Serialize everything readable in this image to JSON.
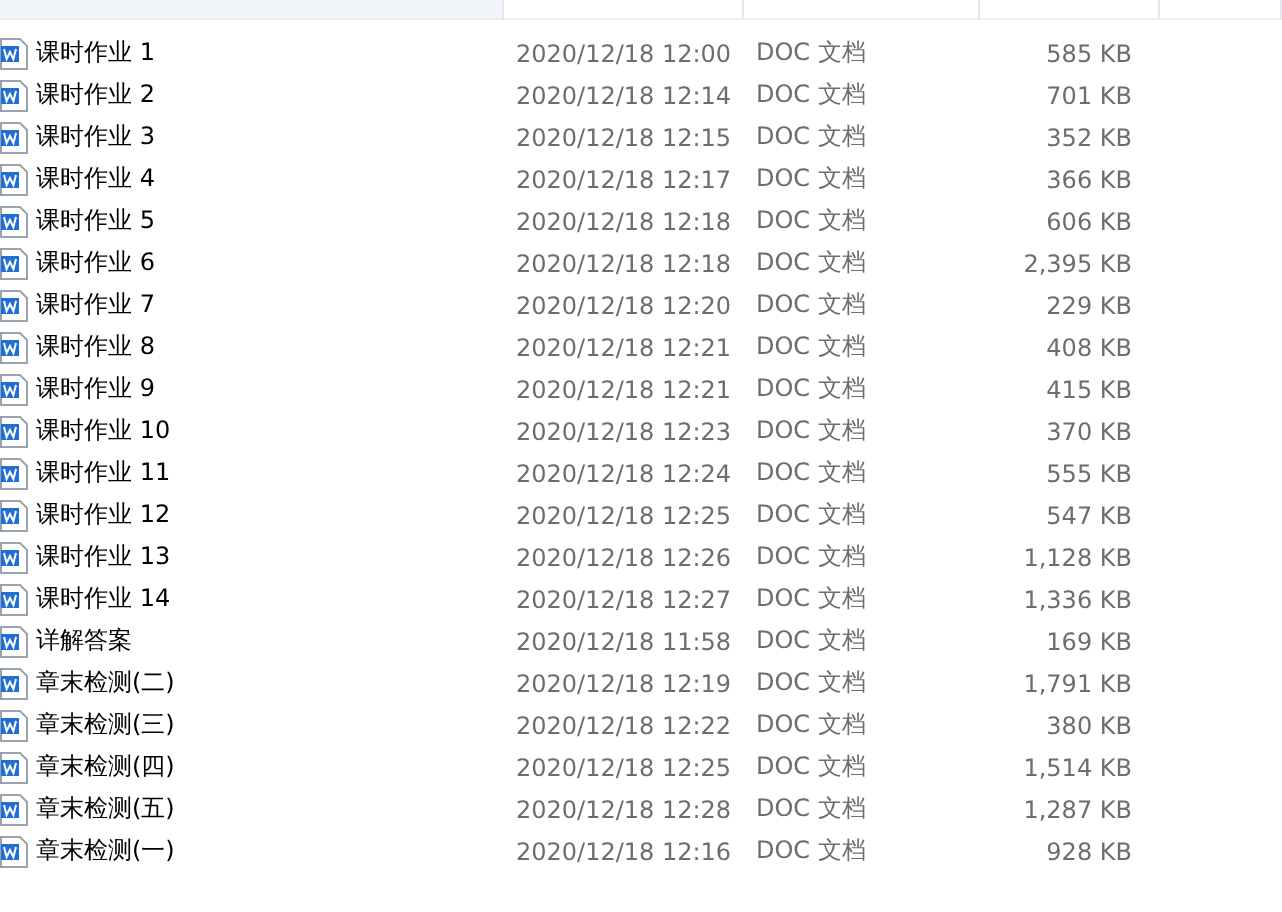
{
  "files": [
    {
      "name": "课时作业 1",
      "modified": "2020/12/18 12:00",
      "type": "DOC 文档",
      "size": "585 KB"
    },
    {
      "name": "课时作业 2",
      "modified": "2020/12/18 12:14",
      "type": "DOC 文档",
      "size": "701 KB"
    },
    {
      "name": "课时作业 3",
      "modified": "2020/12/18 12:15",
      "type": "DOC 文档",
      "size": "352 KB"
    },
    {
      "name": "课时作业 4",
      "modified": "2020/12/18 12:17",
      "type": "DOC 文档",
      "size": "366 KB"
    },
    {
      "name": "课时作业 5",
      "modified": "2020/12/18 12:18",
      "type": "DOC 文档",
      "size": "606 KB"
    },
    {
      "name": "课时作业 6",
      "modified": "2020/12/18 12:18",
      "type": "DOC 文档",
      "size": "2,395 KB"
    },
    {
      "name": "课时作业 7",
      "modified": "2020/12/18 12:20",
      "type": "DOC 文档",
      "size": "229 KB"
    },
    {
      "name": "课时作业 8",
      "modified": "2020/12/18 12:21",
      "type": "DOC 文档",
      "size": "408 KB"
    },
    {
      "name": "课时作业 9",
      "modified": "2020/12/18 12:21",
      "type": "DOC 文档",
      "size": "415 KB"
    },
    {
      "name": "课时作业 10",
      "modified": "2020/12/18 12:23",
      "type": "DOC 文档",
      "size": "370 KB"
    },
    {
      "name": "课时作业 11",
      "modified": "2020/12/18 12:24",
      "type": "DOC 文档",
      "size": "555 KB"
    },
    {
      "name": "课时作业 12",
      "modified": "2020/12/18 12:25",
      "type": "DOC 文档",
      "size": "547 KB"
    },
    {
      "name": "课时作业 13",
      "modified": "2020/12/18 12:26",
      "type": "DOC 文档",
      "size": "1,128 KB"
    },
    {
      "name": "课时作业 14",
      "modified": "2020/12/18 12:27",
      "type": "DOC 文档",
      "size": "1,336 KB"
    },
    {
      "name": "详解答案",
      "modified": "2020/12/18 11:58",
      "type": "DOC 文档",
      "size": "169 KB"
    },
    {
      "name": "章末检测(二)",
      "modified": "2020/12/18 12:19",
      "type": "DOC 文档",
      "size": "1,791 KB"
    },
    {
      "name": "章末检测(三)",
      "modified": "2020/12/18 12:22",
      "type": "DOC 文档",
      "size": "380 KB"
    },
    {
      "name": "章末检测(四)",
      "modified": "2020/12/18 12:25",
      "type": "DOC 文档",
      "size": "1,514 KB"
    },
    {
      "name": "章末检测(五)",
      "modified": "2020/12/18 12:28",
      "type": "DOC 文档",
      "size": "1,287 KB"
    },
    {
      "name": "章末检测(一)",
      "modified": "2020/12/18 12:16",
      "type": "DOC 文档",
      "size": "928 KB"
    }
  ]
}
